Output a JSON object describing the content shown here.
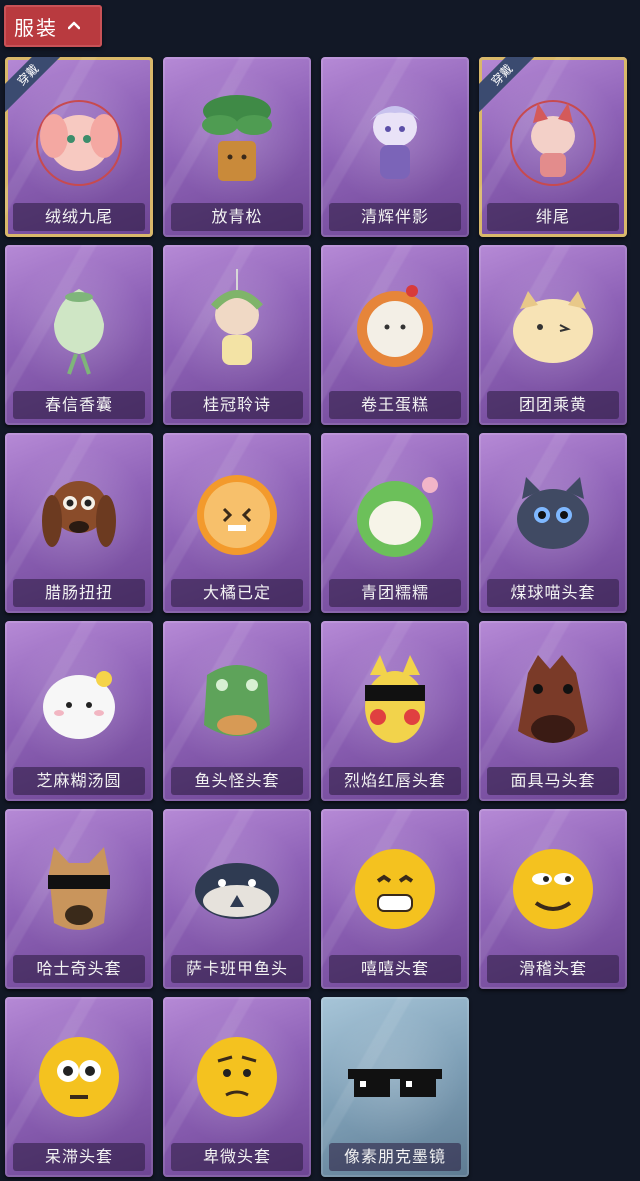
{
  "header": {
    "title": "服装"
  },
  "items": [
    {
      "name": "绒绒九尾",
      "badge": "穿戴"
    },
    {
      "name": "放青松"
    },
    {
      "name": "清辉伴影"
    },
    {
      "name": "绯尾",
      "badge": "穿戴"
    },
    {
      "name": "春信香囊"
    },
    {
      "name": "桂冠聆诗"
    },
    {
      "name": "卷王蛋糕"
    },
    {
      "name": "团团乘黄"
    },
    {
      "name": "腊肠扭扭"
    },
    {
      "name": "大橘已定"
    },
    {
      "name": "青团糯糯"
    },
    {
      "name": "煤球喵头套"
    },
    {
      "name": "芝麻糊汤圆"
    },
    {
      "name": "鱼头怪头套"
    },
    {
      "name": "烈焰红唇头套"
    },
    {
      "name": "面具马头套"
    },
    {
      "name": "哈士奇头套"
    },
    {
      "name": "萨卡班甲鱼头"
    },
    {
      "name": "嘻嘻头套"
    },
    {
      "name": "滑稽头套"
    },
    {
      "name": "呆滞头套"
    },
    {
      "name": "卑微头套"
    },
    {
      "name": "像素朋克墨镜"
    }
  ]
}
